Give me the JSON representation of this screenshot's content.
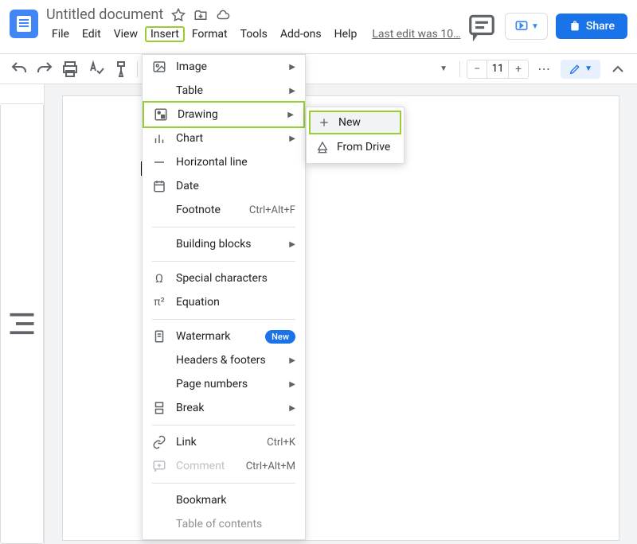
{
  "header": {
    "title": "Untitled document",
    "last_edit": "Last edit was 10…",
    "share": "Share"
  },
  "menubar": [
    "File",
    "Edit",
    "View",
    "Insert",
    "Format",
    "Tools",
    "Add-ons",
    "Help"
  ],
  "toolbar": {
    "font_size": "11"
  },
  "insert_menu": {
    "image": "Image",
    "table": "Table",
    "drawing": "Drawing",
    "chart": "Chart",
    "hr": "Horizontal line",
    "date": "Date",
    "footnote": "Footnote",
    "footnote_sc": "Ctrl+Alt+F",
    "building_blocks": "Building blocks",
    "special_chars": "Special characters",
    "equation": "Equation",
    "watermark": "Watermark",
    "new_badge": "New",
    "headers_footers": "Headers & footers",
    "page_numbers": "Page numbers",
    "break": "Break",
    "link": "Link",
    "link_sc": "Ctrl+K",
    "comment": "Comment",
    "comment_sc": "Ctrl+Alt+M",
    "bookmark": "Bookmark",
    "toc": "Table of contents"
  },
  "drawing_submenu": {
    "new": "New",
    "from_drive": "From Drive"
  }
}
